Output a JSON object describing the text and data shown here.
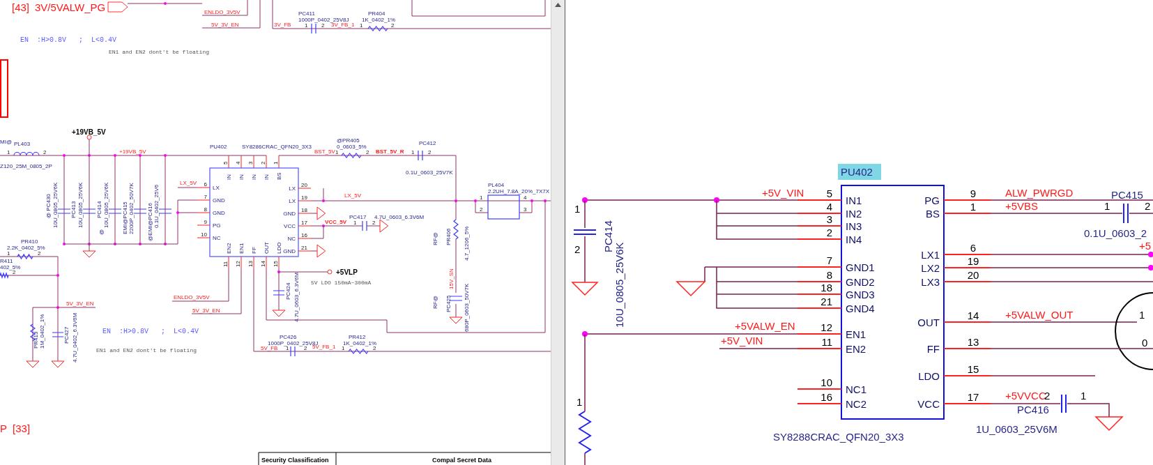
{
  "left_schematic": {
    "chip": {
      "ref": "PU402",
      "part": "SY8286CRAC_QFN20_3X3",
      "pins": [
        {
          "number": "5",
          "name": "IN",
          "kind": "top"
        },
        {
          "number": "4",
          "name": "IN",
          "kind": "top"
        },
        {
          "number": "3",
          "name": "IN",
          "kind": "top"
        },
        {
          "number": "2",
          "name": "IN",
          "kind": "top"
        },
        {
          "number": "1",
          "name": "BS",
          "kind": "top"
        },
        {
          "number": "6",
          "name": "LX",
          "kind": "left"
        },
        {
          "number": "7",
          "name": "GND",
          "kind": "left"
        },
        {
          "number": "8",
          "name": "GND",
          "kind": "left"
        },
        {
          "number": "9",
          "name": "PG",
          "kind": "left"
        },
        {
          "number": "10",
          "name": "NC",
          "kind": "left"
        },
        {
          "number": "20",
          "name": "LX",
          "kind": "right"
        },
        {
          "number": "19",
          "name": "LX",
          "kind": "right"
        },
        {
          "number": "18",
          "name": "GND",
          "kind": "right"
        },
        {
          "number": "17",
          "name": "VCC",
          "kind": "right"
        },
        {
          "number": "16",
          "name": "NC",
          "kind": "right"
        },
        {
          "number": "21",
          "name": "GND",
          "kind": "right"
        },
        {
          "number": "11",
          "name": "EN2",
          "kind": "bottom"
        },
        {
          "number": "12",
          "name": "EN1",
          "kind": "bottom"
        },
        {
          "number": "13",
          "name": "FF",
          "kind": "bottom"
        },
        {
          "number": "14",
          "name": "OUT",
          "kind": "bottom"
        },
        {
          "number": "15",
          "name": "LDO",
          "kind": "bottom"
        }
      ]
    },
    "labels": [
      {
        "text": "[43]",
        "kind": "sheet"
      },
      {
        "text": "3V/5VALW_PG",
        "kind": "sheet"
      },
      {
        "text": "ENLDO_3V5V",
        "kind": "net"
      },
      {
        "text": "5V_3V_EN",
        "kind": "net"
      },
      {
        "text": "3V_FB",
        "kind": "net"
      },
      {
        "text": "PC411",
        "kind": "ref"
      },
      {
        "text": "1000P_0402_25V8J",
        "kind": "value"
      },
      {
        "text": "1",
        "kind": "pin"
      },
      {
        "text": "2",
        "kind": "pin"
      },
      {
        "text": "3V_FB_1",
        "kind": "net"
      },
      {
        "text": "PR404",
        "kind": "ref"
      },
      {
        "text": "1K_0402_1%",
        "kind": "value"
      },
      {
        "text": "1",
        "kind": "pin"
      },
      {
        "text": "2",
        "kind": "pin"
      },
      {
        "text": "EN  :H>0.8V   ;  L<0.4V",
        "kind": "note"
      },
      {
        "text": "EN1 and EN2 dont't be floating",
        "kind": "comment"
      },
      {
        "text": "+19VB_5V",
        "kind": "power"
      },
      {
        "text": "MI@",
        "kind": "value"
      },
      {
        "text": "PL403",
        "kind": "ref"
      },
      {
        "text": "1",
        "kind": "pin"
      },
      {
        "text": "2",
        "kind": "pin"
      },
      {
        "text": "Z120_25M_0805_2P",
        "kind": "value"
      },
      {
        "text": "+19VB_5V",
        "kind": "net"
      },
      {
        "text": "LX_5V",
        "kind": "net"
      },
      {
        "text": "BST_5V",
        "kind": "net"
      },
      {
        "text": "@PR405",
        "kind": "ref"
      },
      {
        "text": "0_0603_5%",
        "kind": "value"
      },
      {
        "text": "1",
        "kind": "pin"
      },
      {
        "text": "2",
        "kind": "pin"
      },
      {
        "text": "BST_5V_R",
        "kind": "netbold"
      },
      {
        "text": "PC412",
        "kind": "ref"
      },
      {
        "text": "1",
        "kind": "pin"
      },
      {
        "text": "2",
        "kind": "pin"
      },
      {
        "text": "0.1U_0603_25V7K",
        "kind": "value"
      },
      {
        "text": "LX_5V",
        "kind": "net"
      },
      {
        "text": "PL404",
        "kind": "ref"
      },
      {
        "text": "2.2UH_7.8A_20%_7X7X",
        "kind": "value"
      },
      {
        "text": "1",
        "kind": "pin"
      },
      {
        "text": "2",
        "kind": "pin"
      },
      {
        "text": "4",
        "kind": "pin"
      },
      {
        "text": "3",
        "kind": "pin"
      },
      {
        "text": "VCC_5V",
        "kind": "netbold"
      },
      {
        "text": "PC417",
        "kind": "ref"
      },
      {
        "text": "4.7U_0603_6.3V6M",
        "kind": "value"
      },
      {
        "text": "1",
        "kind": "pin"
      },
      {
        "text": "2",
        "kind": "pin"
      },
      {
        "text": "+5VLP",
        "kind": "power"
      },
      {
        "text": "5V LDO 150mA~300mA",
        "kind": "comment"
      },
      {
        "text": "RF@",
        "kind": "value"
      },
      {
        "text": "PR406",
        "kind": "ref"
      },
      {
        "text": "4.7_1206_5%",
        "kind": "value"
      },
      {
        "text": "15V_SN",
        "kind": "net"
      },
      {
        "text": "RF@",
        "kind": "value"
      },
      {
        "text": "PC425",
        "kind": "ref"
      },
      {
        "text": "680P_0603_50V7K",
        "kind": "value"
      },
      {
        "text": "PC424",
        "kind": "ref"
      },
      {
        "text": "4.7U_0603_6.3V6M",
        "kind": "value"
      },
      {
        "text": "@ PC430",
        "kind": "ref"
      },
      {
        "text": "10U_0805_25V6K",
        "kind": "value"
      },
      {
        "text": "PC413",
        "kind": "ref"
      },
      {
        "text": "10U_0805_25V6K",
        "kind": "value"
      },
      {
        "text": "@",
        "kind": "ref"
      },
      {
        "text": "PC414",
        "kind": "ref"
      },
      {
        "text": "10U_0805_25V6K",
        "kind": "value"
      },
      {
        "text": "EMI@PC415",
        "kind": "ref"
      },
      {
        "text": "2200P_0402_50V7K",
        "kind": "value"
      },
      {
        "text": "@EMI@PC416",
        "kind": "ref"
      },
      {
        "text": "0.1U_0402_25V6",
        "kind": "value"
      },
      {
        "text": "PR410",
        "kind": "ref"
      },
      {
        "text": "2.2K_0402_5%",
        "kind": "value"
      },
      {
        "text": "1",
        "kind": "pin"
      },
      {
        "text": "2",
        "kind": "pin"
      },
      {
        "text": "R411",
        "kind": "ref"
      },
      {
        "text": "402_5%",
        "kind": "value"
      },
      {
        "text": "2",
        "kind": "pin"
      },
      {
        "text": "ENLDO_3V5V",
        "kind": "net"
      },
      {
        "text": "5V_3V_EN",
        "kind": "net"
      },
      {
        "text": "5V_3V_EN",
        "kind": "net"
      },
      {
        "text": "EN  :H>0.8V   ;  L<0.4V",
        "kind": "note"
      },
      {
        "text": "EN1 and EN2 dont't be floating",
        "kind": "comment"
      },
      {
        "text": "1M_0402_1%",
        "kind": "value"
      },
      {
        "text": "PC427",
        "kind": "ref"
      },
      {
        "text": "PR413",
        "kind": "ref"
      },
      {
        "text": "4.7U_0402_6.3V6M",
        "kind": "value"
      },
      {
        "text": "PC426",
        "kind": "ref"
      },
      {
        "text": "1000P_0402_25V8J",
        "kind": "value"
      },
      {
        "text": "5V_FB",
        "kind": "net"
      },
      {
        "text": "1",
        "kind": "pin"
      },
      {
        "text": "2",
        "kind": "pin"
      },
      {
        "text": "5V_FB_1",
        "kind": "net"
      },
      {
        "text": "PR412",
        "kind": "ref"
      },
      {
        "text": "1K_0402_1%",
        "kind": "value"
      },
      {
        "text": "1",
        "kind": "pin"
      },
      {
        "text": "2",
        "kind": "pin"
      },
      {
        "text": "P  [33]",
        "kind": "sheet"
      },
      {
        "text": "Security Classification",
        "kind": "title"
      },
      {
        "text": "Compal Secret Data",
        "kind": "title"
      }
    ]
  },
  "right_schematic": {
    "chip": {
      "ref": "PU402",
      "part": "SY8288CRAC_QFN20_3X3",
      "pins": [
        {
          "number": "5",
          "name": "IN1",
          "kind": "left"
        },
        {
          "number": "4",
          "name": "IN2",
          "kind": "left"
        },
        {
          "number": "3",
          "name": "IN3",
          "kind": "left"
        },
        {
          "number": "2",
          "name": "IN4",
          "kind": "left"
        },
        {
          "number": "7",
          "name": "GND1",
          "kind": "left"
        },
        {
          "number": "8",
          "name": "GND2",
          "kind": "left"
        },
        {
          "number": "18",
          "name": "GND3",
          "kind": "left"
        },
        {
          "number": "21",
          "name": "GND4",
          "kind": "left"
        },
        {
          "number": "12",
          "name": "EN1",
          "kind": "left"
        },
        {
          "number": "11",
          "name": "EN2",
          "kind": "left"
        },
        {
          "number": "10",
          "name": "NC1",
          "kind": "left"
        },
        {
          "number": "16",
          "name": "NC2",
          "kind": "left"
        },
        {
          "number": "9",
          "name": "PG",
          "kind": "right"
        },
        {
          "number": "1",
          "name": "BS",
          "kind": "right"
        },
        {
          "number": "6",
          "name": "LX1",
          "kind": "right"
        },
        {
          "number": "19",
          "name": "LX2",
          "kind": "right"
        },
        {
          "number": "20",
          "name": "LX3",
          "kind": "right"
        },
        {
          "number": "14",
          "name": "OUT",
          "kind": "right"
        },
        {
          "number": "13",
          "name": "FF",
          "kind": "right"
        },
        {
          "number": "15",
          "name": "LDO",
          "kind": "right"
        },
        {
          "number": "17",
          "name": "VCC",
          "kind": "right"
        }
      ]
    },
    "labels": [
      {
        "text": "PC414",
        "kind": "ref"
      },
      {
        "text": "10U_0805_25V6K",
        "kind": "value"
      },
      {
        "text": "1",
        "kind": "pin"
      },
      {
        "text": "2",
        "kind": "pin"
      },
      {
        "text": "+5V_VIN",
        "kind": "net"
      },
      {
        "text": "+5VALW_EN",
        "kind": "net"
      },
      {
        "text": "+5V_VIN",
        "kind": "net"
      },
      {
        "text": "ALW_PWRGD",
        "kind": "net"
      },
      {
        "text": "+5VBS",
        "kind": "net"
      },
      {
        "text": "PC415",
        "kind": "ref"
      },
      {
        "text": "1",
        "kind": "pin"
      },
      {
        "text": "2",
        "kind": "pin"
      },
      {
        "text": "0.1U_0603_2",
        "kind": "value"
      },
      {
        "text": "+5",
        "kind": "net"
      },
      {
        "text": "+5VALW_OUT",
        "kind": "net"
      },
      {
        "text": "1",
        "kind": "pin"
      },
      {
        "text": "0",
        "kind": "pin"
      },
      {
        "text": "+5VVCC",
        "kind": "net"
      },
      {
        "text": "2",
        "kind": "pin"
      },
      {
        "text": "1",
        "kind": "pin"
      },
      {
        "text": "PC416",
        "kind": "ref"
      },
      {
        "text": "1U_0603_25V6M",
        "kind": "value"
      },
      {
        "text": "1",
        "kind": "pin"
      }
    ]
  }
}
